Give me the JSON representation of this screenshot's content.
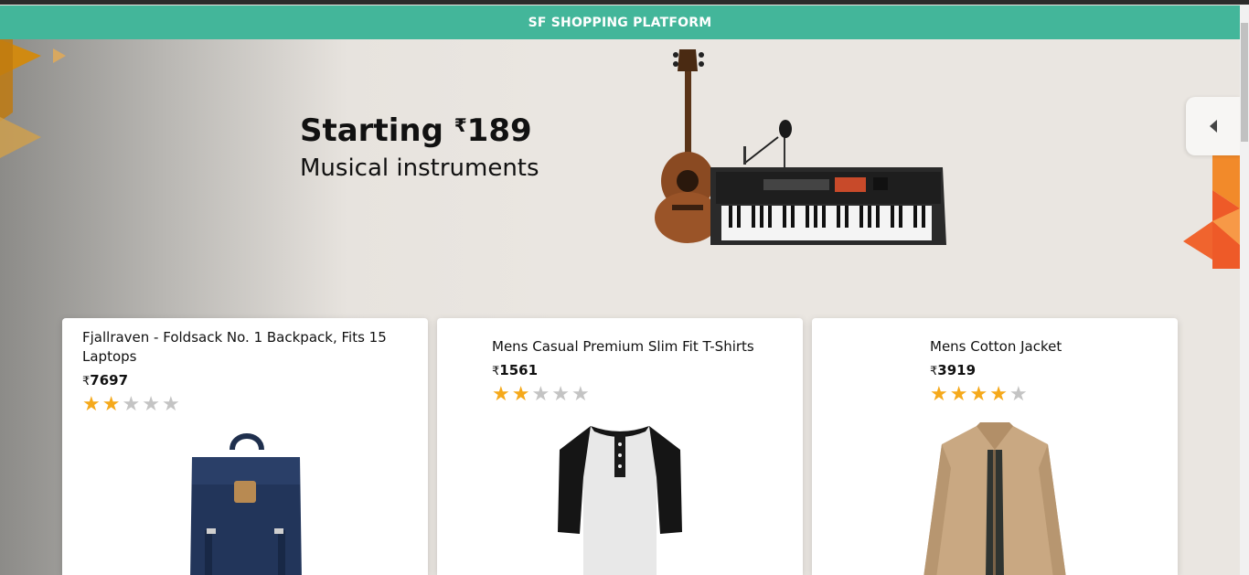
{
  "navbar": {
    "title": "SF SHOPPING PLATFORM"
  },
  "banner": {
    "title_prefix": "Starting ",
    "currency": "₹",
    "price": "189",
    "subtitle": "Musical instruments",
    "image": "ukulele-and-keyboard-image",
    "nav_icon": "chevron-left-icon"
  },
  "products": [
    {
      "title": "Fjallraven - Foldsack No. 1 Backpack, Fits 15 Laptops",
      "currency": "₹",
      "price": "7697",
      "rating": 2,
      "max_rating": 5,
      "image": "backpack-image"
    },
    {
      "title": "Mens Casual Premium Slim Fit T-Shirts",
      "currency": "₹",
      "price": "1561",
      "rating": 2,
      "max_rating": 5,
      "image": "tshirt-image"
    },
    {
      "title": "Mens Cotton Jacket",
      "currency": "₹",
      "price": "3919",
      "rating": 4,
      "max_rating": 5,
      "image": "jacket-image"
    }
  ],
  "colors": {
    "navbar": "#43b69a",
    "star_filled": "#f5a91b",
    "star_empty": "#c4c4c4"
  }
}
